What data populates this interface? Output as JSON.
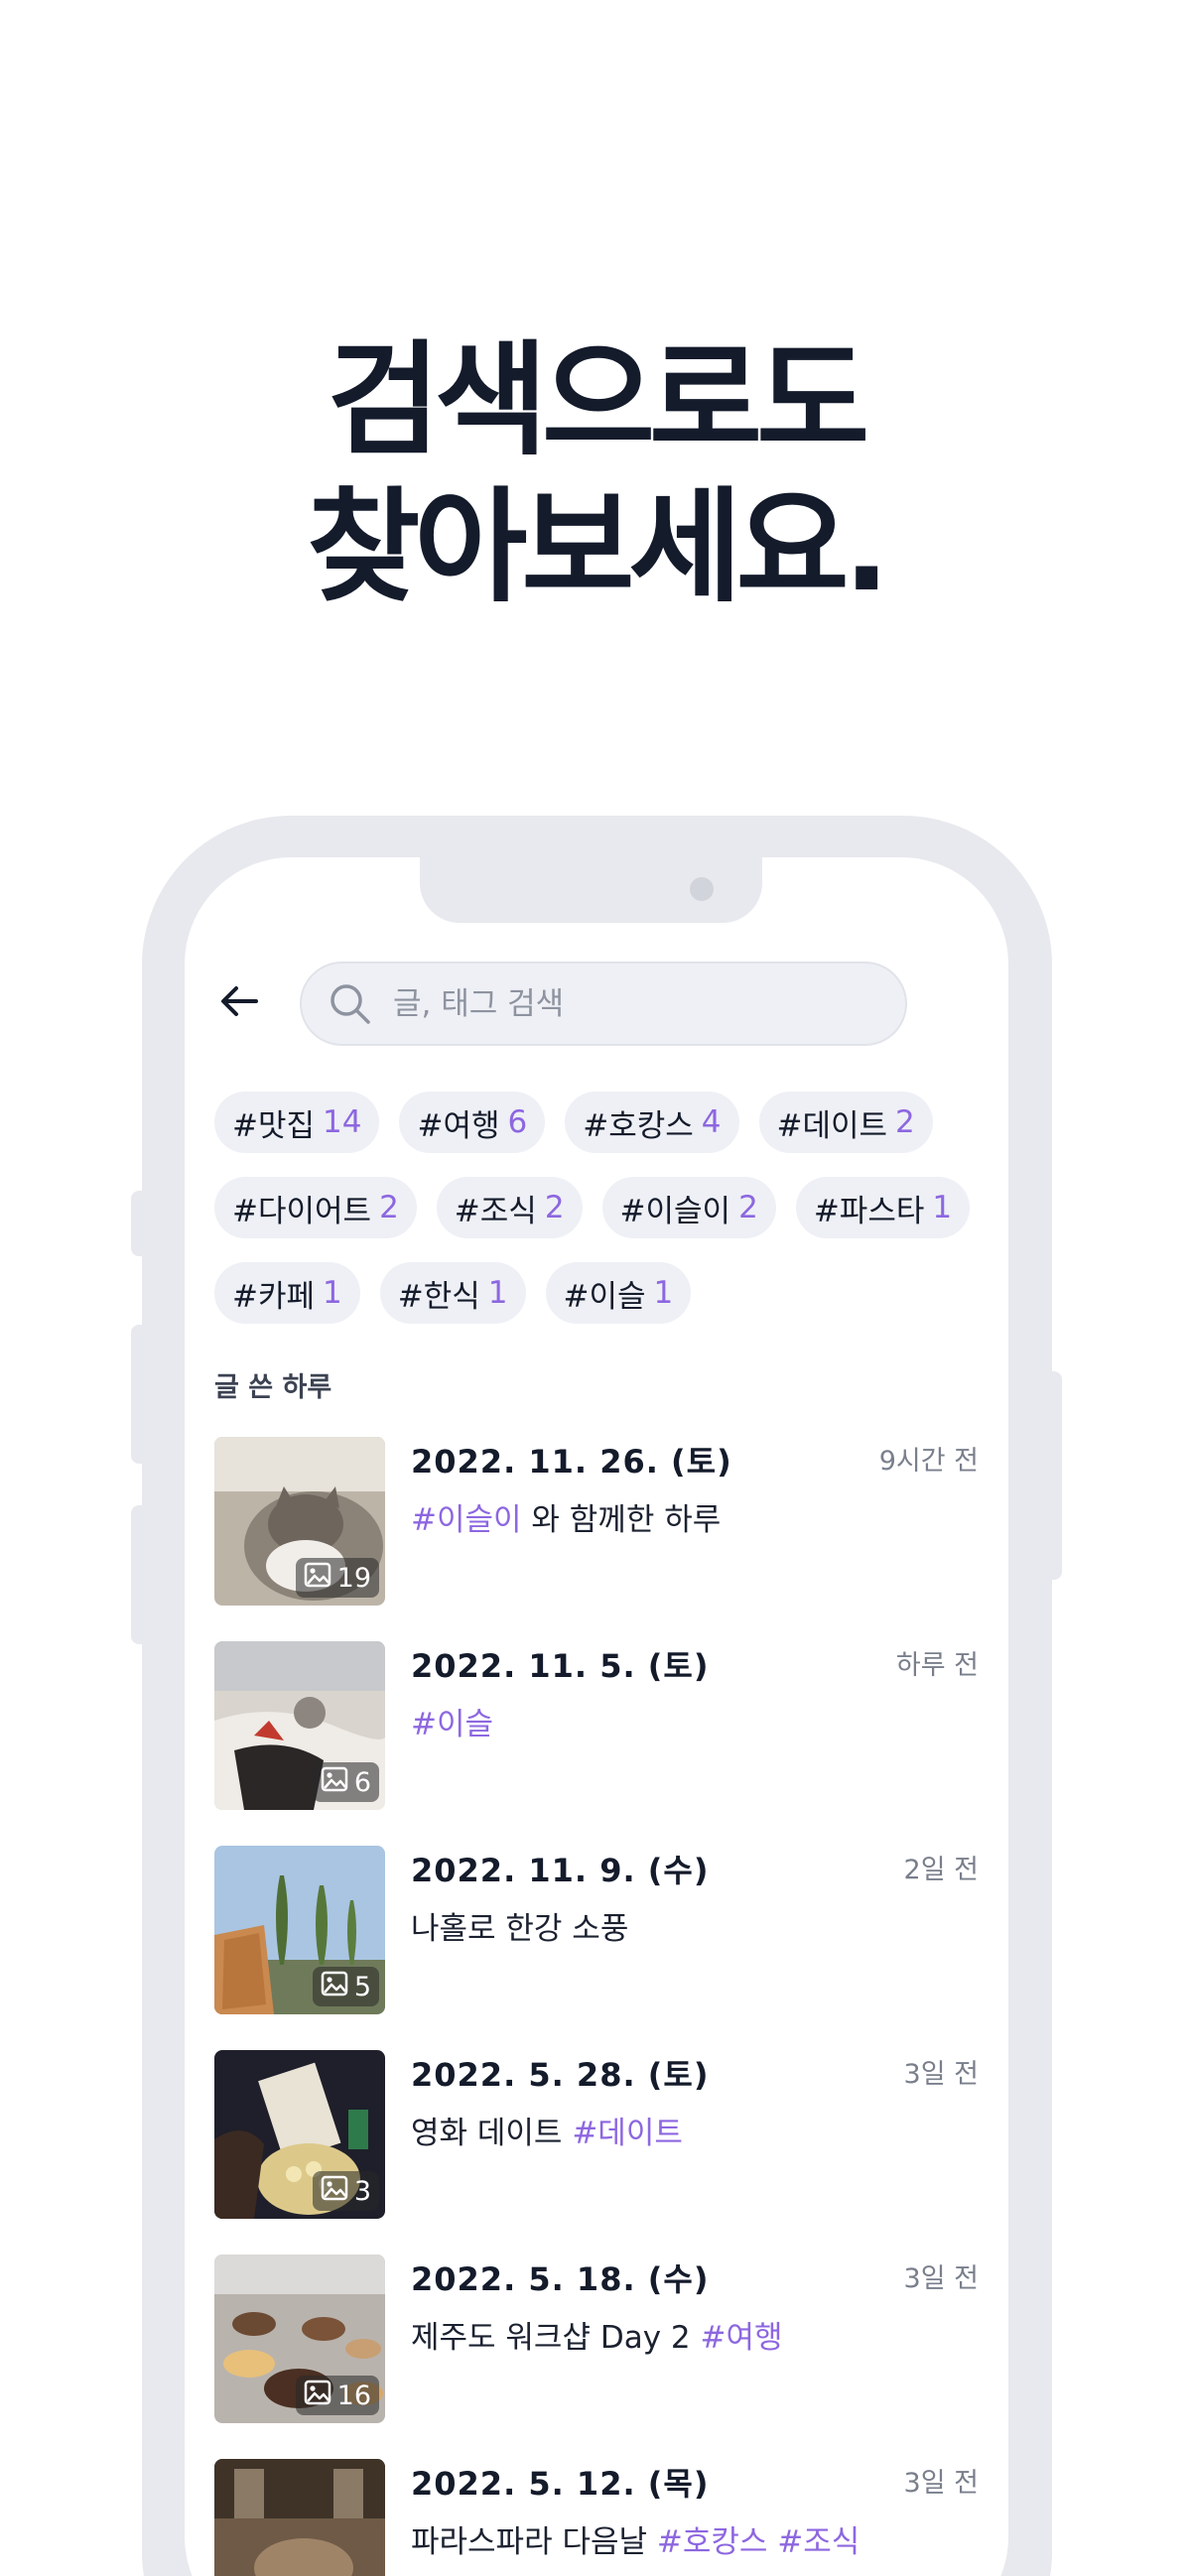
{
  "headline": {
    "line1": "검색으로도",
    "line2": "찾아보세요."
  },
  "search": {
    "placeholder": "글, 태그 검색",
    "value": ""
  },
  "tags": [
    {
      "label": "#맛집",
      "count": "14"
    },
    {
      "label": "#여행",
      "count": "6"
    },
    {
      "label": "#호캉스",
      "count": "4"
    },
    {
      "label": "#데이트",
      "count": "2"
    },
    {
      "label": "#다이어트",
      "count": "2"
    },
    {
      "label": "#조식",
      "count": "2"
    },
    {
      "label": "#이슬이",
      "count": "2"
    },
    {
      "label": "#파스타",
      "count": "1"
    },
    {
      "label": "#카페",
      "count": "1"
    },
    {
      "label": "#한식",
      "count": "1"
    },
    {
      "label": "#이슬",
      "count": "1"
    }
  ],
  "section_title": "글 쓴 하루",
  "posts": [
    {
      "date": "2022. 11. 26. (토)",
      "ago": "9시간 전",
      "text": "와 함께한 하루",
      "tag_before": "#이슬이",
      "tags_after": "",
      "photos": "19"
    },
    {
      "date": "2022. 11. 5. (토)",
      "ago": "하루 전",
      "text": "",
      "tag_before": "#이슬",
      "tags_after": "",
      "photos": "6"
    },
    {
      "date": "2022. 11. 9. (수)",
      "ago": "2일 전",
      "text": "나홀로 한강 소풍",
      "tag_before": "",
      "tags_after": "",
      "photos": "5"
    },
    {
      "date": "2022. 5. 28. (토)",
      "ago": "3일 전",
      "text": "영화 데이트",
      "tag_before": "",
      "tags_after": "#데이트",
      "photos": "3"
    },
    {
      "date": "2022. 5. 18. (수)",
      "ago": "3일 전",
      "text": "제주도 워크샵 Day 2",
      "tag_before": "",
      "tags_after": "#여행",
      "photos": "16"
    },
    {
      "date": "2022. 5. 12. (목)",
      "ago": "3일 전",
      "text": "파라스파라 다음날",
      "tag_before": "",
      "tags_after": "#호캉스 #조식",
      "photos": ""
    }
  ],
  "colors": {
    "accent": "#8d67e0",
    "frame": "#e8e9ee",
    "chip": "#eef0f5",
    "text": "#141b2b"
  }
}
